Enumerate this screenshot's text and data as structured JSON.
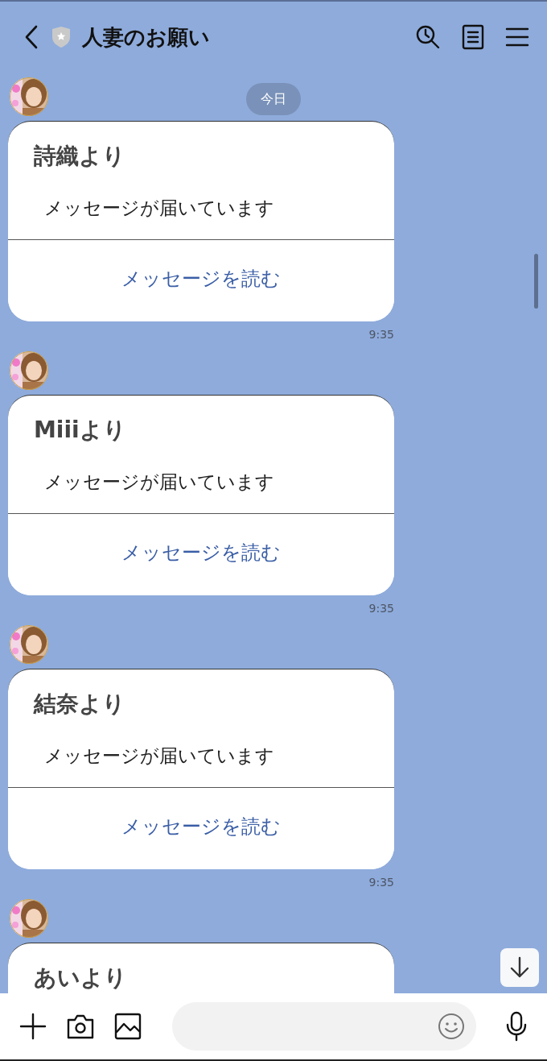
{
  "header": {
    "title": "人妻のお願い"
  },
  "date_label": "今日",
  "messages": [
    {
      "title": "詩織より",
      "body": "メッセージが届いています",
      "action": "メッセージを読む",
      "time": "9:35"
    },
    {
      "title": "Miiiより",
      "body": "メッセージが届いています",
      "action": "メッセージを読む",
      "time": "9:35"
    },
    {
      "title": "結奈より",
      "body": "メッセージが届いています",
      "action": "メッセージを読む",
      "time": "9:35"
    },
    {
      "title": "あいより"
    }
  ]
}
